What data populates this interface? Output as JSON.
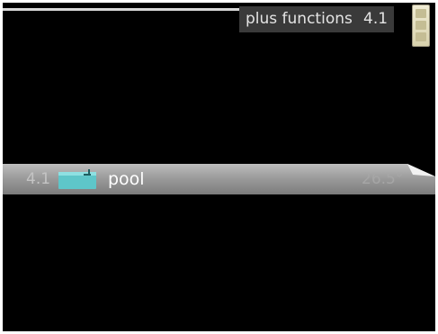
{
  "header": {
    "title": "plus functions",
    "menu_number": "4.1"
  },
  "scrollbar": {
    "icon": "scroll-up-down-icon"
  },
  "menu": {
    "items": [
      {
        "number": "4.1",
        "icon": "pool-icon",
        "label": "pool",
        "value": "26.5°"
      }
    ]
  },
  "colors": {
    "background": "#000000",
    "row_highlight": "#a3a3a3",
    "pool_icon": "#5ec6c9",
    "title_box": "#3a3a3a"
  }
}
